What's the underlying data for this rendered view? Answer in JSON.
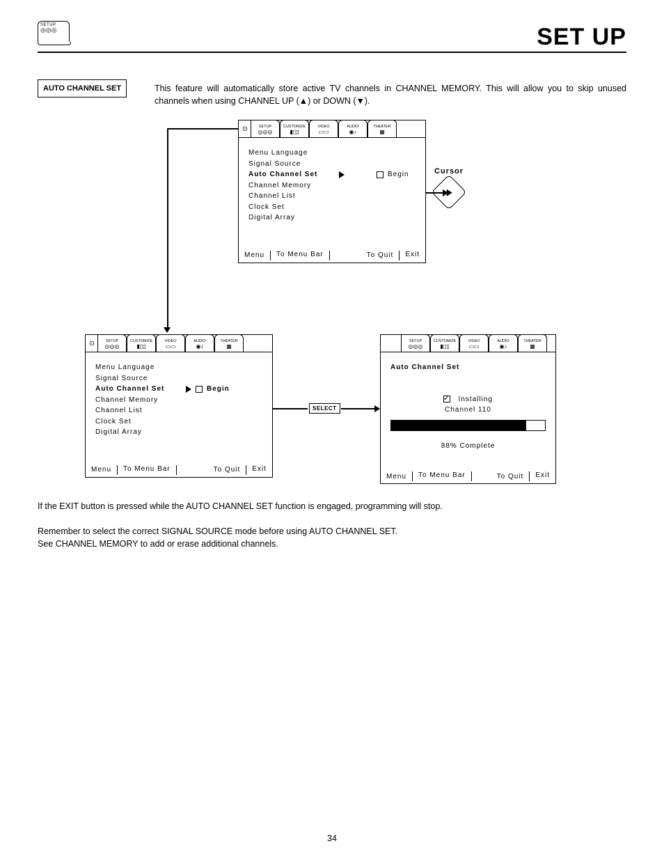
{
  "page": {
    "title": "SET UP",
    "number": "34"
  },
  "corner_tab": {
    "label": "SETUP",
    "icon_glyph": "◎◎◎"
  },
  "section_label": "AUTO CHANNEL SET",
  "intro": {
    "line1": "This feature will automatically store active TV channels in CHANNEL MEMORY.  This will allow you to skip unused channels when using CHANNEL UP (▲) or DOWN (▼)."
  },
  "tabs": [
    {
      "label": "SETUP",
      "icon": "◎◎◎"
    },
    {
      "label": "CUSTOMIZE",
      "icon": "▮▯▯"
    },
    {
      "label": "VIDEO",
      "icon": "▭▭"
    },
    {
      "label": "AUDIO",
      "icon": "◉♪"
    },
    {
      "label": "THEATER",
      "icon": "▦"
    }
  ],
  "selector_icon": "⊙",
  "menu_items": [
    "Menu Language",
    "Signal Source",
    "Auto Channel Set",
    "Channel Memory",
    "Channel List",
    "Clock Set",
    "Digital Array"
  ],
  "begin_label": "Begin",
  "footer": {
    "menu": "Menu",
    "to_menu_bar": "To Menu Bar",
    "to_quit": "To Quit",
    "exit": "Exit"
  },
  "cursor_label": "Cursor",
  "select_label": "SELECT",
  "osd3": {
    "title": "Auto Channel Set",
    "installing": "Installing",
    "channel": "Channel 110",
    "percent_text": "88% Complete",
    "percent_value": 88
  },
  "para1": "If the EXIT button is pressed while the AUTO CHANNEL SET function is engaged, programming will stop.",
  "para2a": "Remember to select the correct SIGNAL SOURCE mode before using AUTO CHANNEL SET.",
  "para2b": "See CHANNEL MEMORY to add or erase additional channels."
}
